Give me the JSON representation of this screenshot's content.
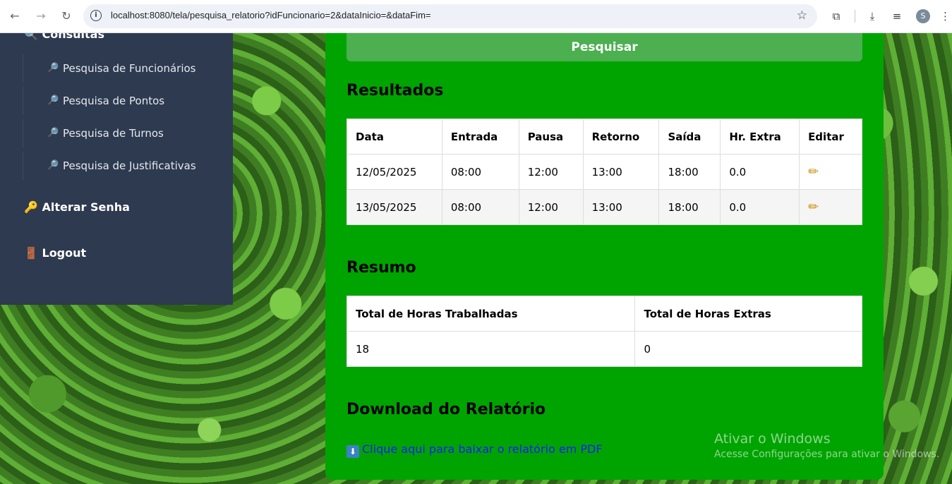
{
  "browser": {
    "url": "localhost:8080/tela/pesquisa_relatorio?idFuncionario=2&dataInicio=&dataFim=",
    "profile_initial": "S"
  },
  "sidebar": {
    "heading": "🔍 Consultas",
    "sub_items": [
      {
        "icon": "🔎",
        "label": "Pesquisa de Funcionários"
      },
      {
        "icon": "🔎",
        "label": "Pesquisa de Pontos"
      },
      {
        "icon": "🔎",
        "label": "Pesquisa de Turnos"
      },
      {
        "icon": "🔎",
        "label": "Pesquisa de Justificativas"
      }
    ],
    "change_password": "🔑 Alterar Senha",
    "logout": "🚪 Logout"
  },
  "main": {
    "search_button": "Pesquisar",
    "results_title": "Resultados",
    "results_headers": [
      "Data",
      "Entrada",
      "Pausa",
      "Retorno",
      "Saída",
      "Hr. Extra",
      "Editar"
    ],
    "results_rows": [
      [
        "12/05/2025",
        "08:00",
        "12:00",
        "13:00",
        "18:00",
        "0.0"
      ],
      [
        "13/05/2025",
        "08:00",
        "12:00",
        "13:00",
        "18:00",
        "0.0"
      ]
    ],
    "summary_title": "Resumo",
    "summary_headers": [
      "Total de Horas Trabalhadas",
      "Total de Horas Extras"
    ],
    "summary_values": [
      "18",
      "0"
    ],
    "download_title": "Download do Relatório",
    "download_link": "Clique aqui para baixar o relatório em PDF",
    "download_icon": "⬇"
  },
  "watermark": {
    "line1": "Ativar o Windows",
    "line2": "Acesse Configurações para ativar o Windows."
  }
}
